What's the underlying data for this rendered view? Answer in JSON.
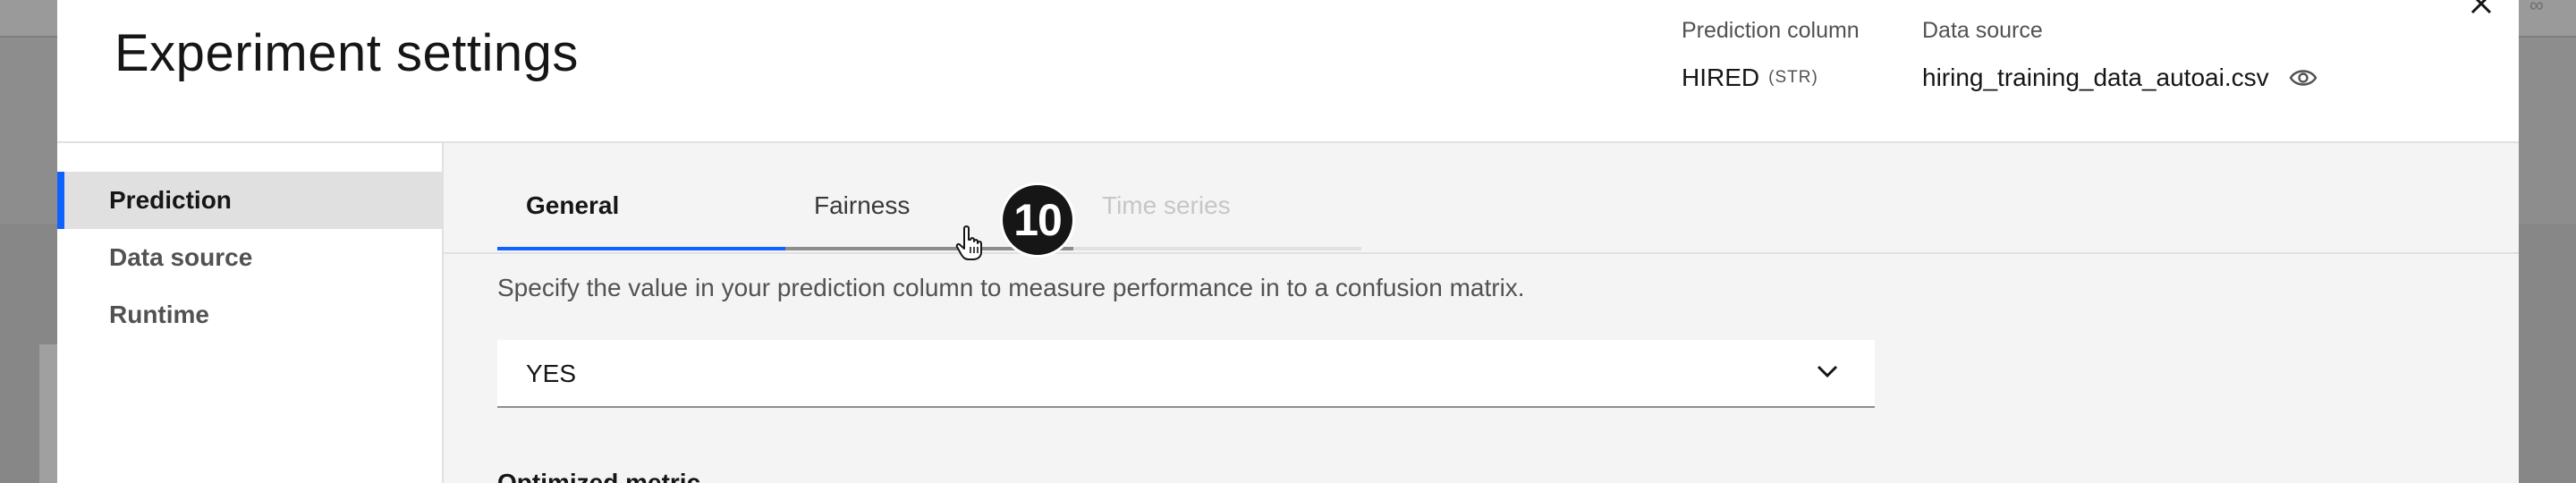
{
  "modal": {
    "title": "Experiment settings",
    "prediction_column": {
      "label": "Prediction column",
      "value": "HIRED",
      "type": "(STR)"
    },
    "data_source": {
      "label": "Data source",
      "value": "hiring_training_data_autoai.csv"
    }
  },
  "sidebar": {
    "items": [
      {
        "label": "Prediction",
        "active": true
      },
      {
        "label": "Data source",
        "active": false
      },
      {
        "label": "Runtime",
        "active": false
      }
    ]
  },
  "tabs": [
    {
      "label": "General",
      "state": "selected"
    },
    {
      "label": "Fairness",
      "state": "normal"
    },
    {
      "label": "Time series",
      "state": "disabled"
    }
  ],
  "step_badge": "10",
  "general": {
    "description": "Specify the value in your prediction column to measure performance in to a confusion matrix.",
    "positive_class": {
      "selected": "YES"
    },
    "next_section_heading": "Optimized metric"
  },
  "colors": {
    "accent": "#0f62fe",
    "active_nav_bg": "#e0e0e0",
    "content_bg": "#f4f4f4",
    "badge_bg": "#161616"
  },
  "icons": {
    "close": "close-icon",
    "eye": "eye-icon",
    "dropdown": "chevron-down-icon",
    "cursor": "hand-pointer-icon"
  }
}
